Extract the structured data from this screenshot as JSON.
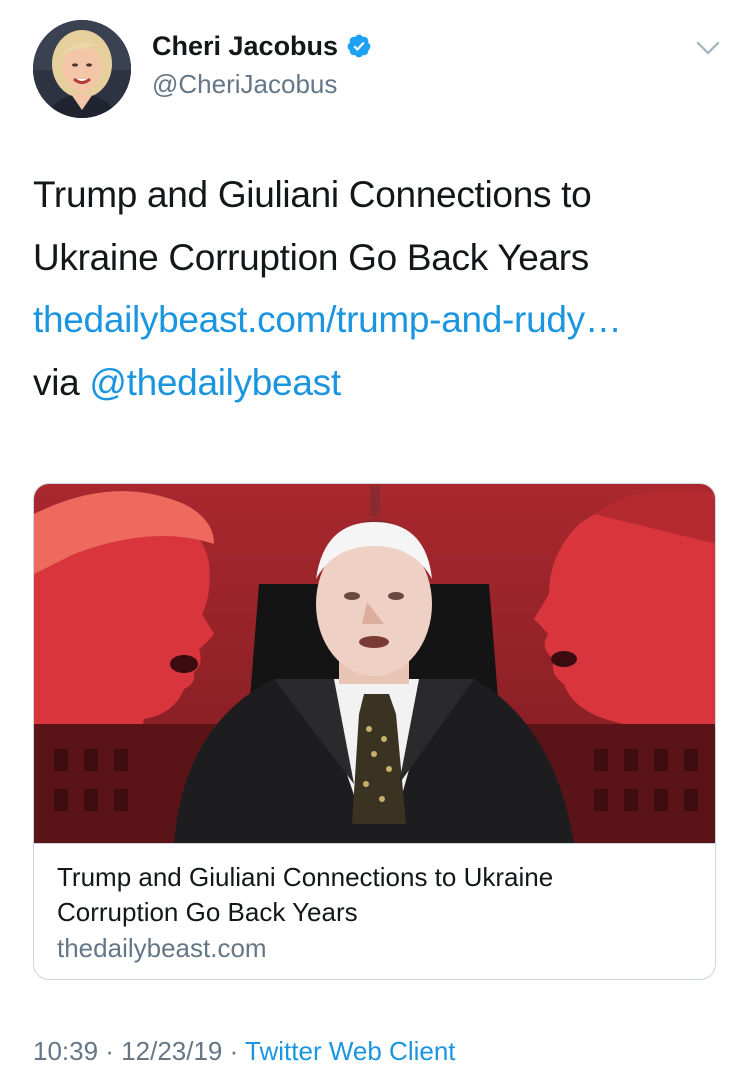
{
  "author": {
    "display_name": "Cheri Jacobus",
    "handle": "@CheriJacobus",
    "verified_icon": "verified-badge-icon"
  },
  "tweet": {
    "text_line_1": "Trump and Giuliani Connections to",
    "text_line_2": "Ukraine Corruption Go Back Years",
    "link": "thedailybeast.com/trump-and-rudy…",
    "via_prefix": "via ",
    "mention": "@thedailybeast"
  },
  "card": {
    "title_line_1": "Trump and Giuliani Connections to Ukraine",
    "title_line_2": "Corruption Go Back Years",
    "domain": "thedailybeast.com"
  },
  "meta": {
    "time": "10:39",
    "separator": " · ",
    "date": "12/23/19",
    "source": "Twitter Web Client"
  },
  "colors": {
    "link": "#1b95e0",
    "secondary_text": "#657786",
    "primary_text": "#14171a",
    "border": "#ccd6dd",
    "image_red": "#c8262c"
  }
}
